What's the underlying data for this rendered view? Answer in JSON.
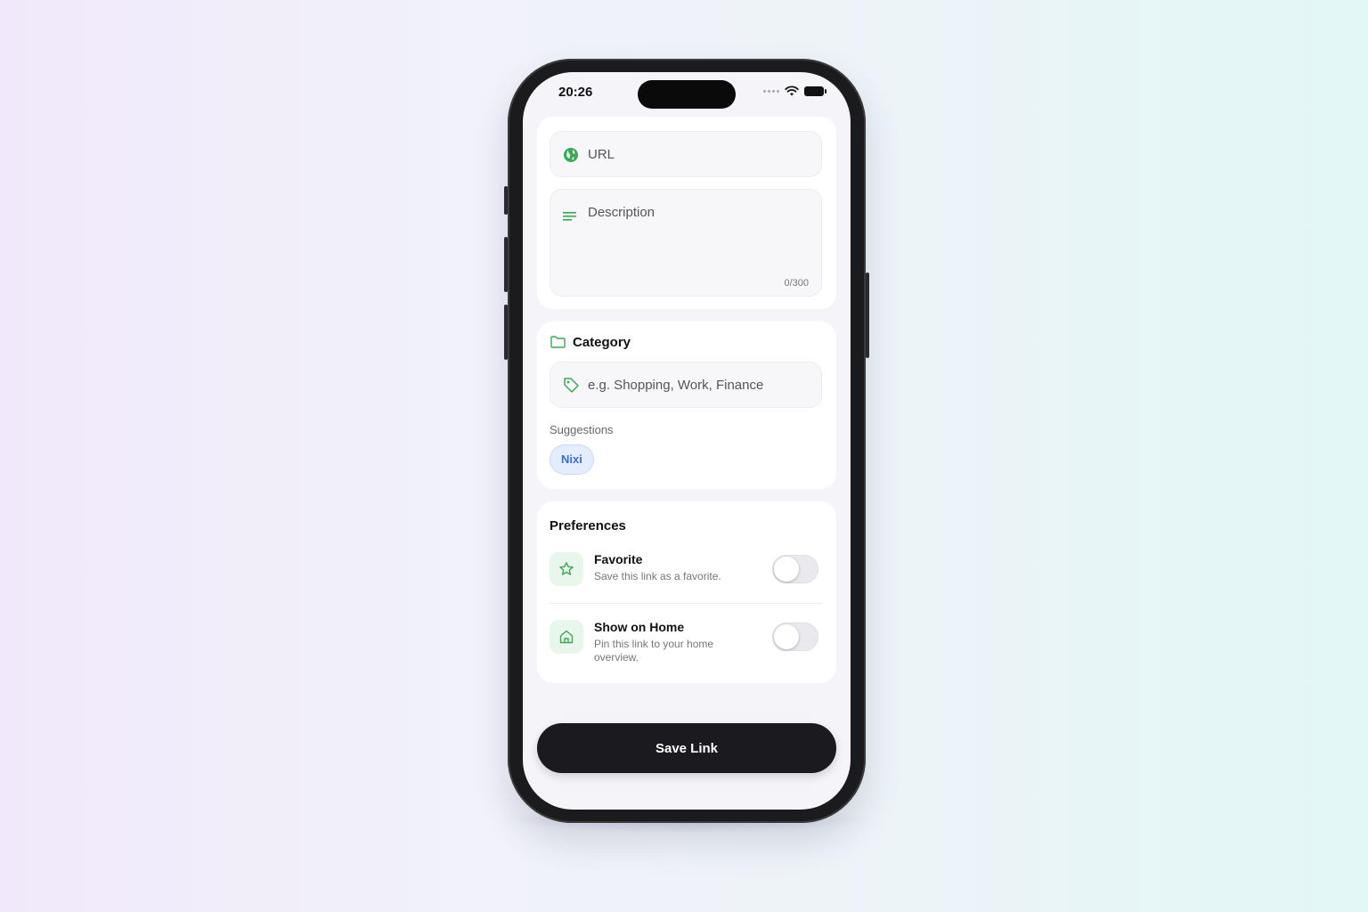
{
  "status_bar": {
    "time": "20:26"
  },
  "link_card": {
    "url_placeholder": "URL",
    "description_placeholder": "Description",
    "description_counter": "0/300"
  },
  "category": {
    "title": "Category",
    "input_placeholder": "e.g. Shopping, Work, Finance",
    "suggestions_label": "Suggestions",
    "suggestions": [
      "Nixi"
    ]
  },
  "preferences": {
    "title": "Preferences",
    "items": [
      {
        "title": "Favorite",
        "description": "Save this link as a favorite.",
        "icon": "star-icon",
        "enabled": false
      },
      {
        "title": "Show on Home",
        "description": "Pin this link to your home overview.",
        "icon": "home-icon",
        "enabled": false
      }
    ]
  },
  "actions": {
    "save_label": "Save Link"
  },
  "colors": {
    "accent_green": "#3aa856",
    "chip_blue": "#3a6fd8",
    "button_dark": "#1a1a1f"
  }
}
